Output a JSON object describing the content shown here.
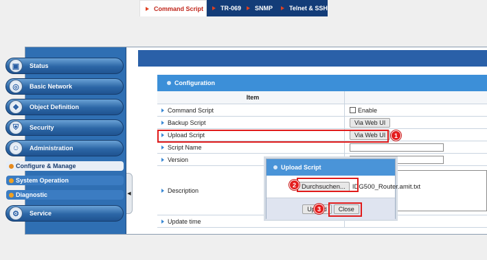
{
  "sidebar": {
    "items": [
      {
        "label": "Status",
        "icon": "status-icon"
      },
      {
        "label": "Basic Network",
        "icon": "network-icon"
      },
      {
        "label": "Object Definition",
        "icon": "object-icon"
      },
      {
        "label": "Security",
        "icon": "security-icon"
      },
      {
        "label": "Administration",
        "icon": "admin-icon"
      }
    ],
    "subitems": [
      {
        "label": "Configure & Manage",
        "active": true
      },
      {
        "label": "System Operation",
        "active": false
      },
      {
        "label": "Diagnostic",
        "active": false
      }
    ],
    "service": {
      "label": "Service",
      "icon": "service-icon"
    }
  },
  "tabs": [
    "Command Script",
    "TR-069",
    "SNMP",
    "Telnet & SSH"
  ],
  "config": {
    "header": "Configuration",
    "col_item": "Item",
    "rows": {
      "command_script": "Command Script",
      "command_enable": "Enable",
      "backup_script": "Backup Script",
      "backup_btn": "Via Web UI",
      "upload_script": "Upload Script",
      "upload_btn": "Via Web UI",
      "script_name": "Script Name",
      "version": "Version",
      "description": "Description",
      "update_time": "Update time"
    }
  },
  "dialog": {
    "title": "Upload Script",
    "browse": "Durchsuchen...",
    "filename": "IDG500_Router.amit.txt",
    "upload": "Upload",
    "close": "Close"
  },
  "badges": [
    "1",
    "2",
    "3"
  ]
}
